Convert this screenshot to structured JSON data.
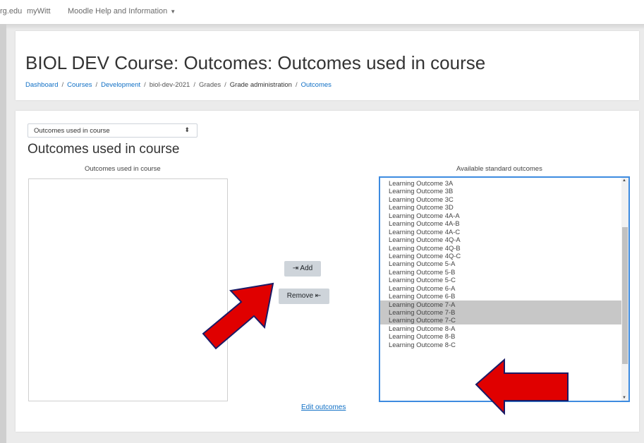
{
  "topnav": {
    "items": [
      "rg.edu",
      "myWitt",
      "Moodle Help and Information"
    ],
    "dropdown_caret": "▼"
  },
  "header": {
    "title": "BIOL DEV Course: Outcomes: Outcomes used in course",
    "breadcrumb": [
      "Dashboard",
      "Courses",
      "Development",
      "biol-dev-2021",
      "Grades",
      "Grade administration",
      "Outcomes"
    ],
    "separator": "/"
  },
  "main": {
    "select_value": "Outcomes used in course",
    "select_arrows": "⬍",
    "section_title": "Outcomes used in course",
    "left_label": "Outcomes used in course",
    "right_label": "Available standard outcomes",
    "add_label": "⇥ Add",
    "remove_label": "Remove ⇤",
    "edit_link": "Edit outcomes",
    "available": [
      {
        "label": "Learning Outcome 3A",
        "selected": false
      },
      {
        "label": "Learning Outcome 3B",
        "selected": false
      },
      {
        "label": "Learning Outcome 3C",
        "selected": false
      },
      {
        "label": "Learning Outcome 3D",
        "selected": false
      },
      {
        "label": "Learning Outcome 4A-A",
        "selected": false
      },
      {
        "label": "Learning Outcome 4A-B",
        "selected": false
      },
      {
        "label": "Learning Outcome 4A-C",
        "selected": false
      },
      {
        "label": "Learning Outcome 4Q-A",
        "selected": false
      },
      {
        "label": "Learning Outcome 4Q-B",
        "selected": false
      },
      {
        "label": "Learning Outcome 4Q-C",
        "selected": false
      },
      {
        "label": "Learning Outcome 5-A",
        "selected": false
      },
      {
        "label": "Learning Outcome 5-B",
        "selected": false
      },
      {
        "label": "Learning Outcome 5-C",
        "selected": false
      },
      {
        "label": "Learning Outcome 6-A",
        "selected": false
      },
      {
        "label": "Learning Outcome 6-B",
        "selected": false
      },
      {
        "label": "Learning Outcome 7-A",
        "selected": true
      },
      {
        "label": "Learning Outcome 7-B",
        "selected": true
      },
      {
        "label": "Learning Outcome 7-C",
        "selected": true
      },
      {
        "label": "Learning Outcome 8-A",
        "selected": false
      },
      {
        "label": "Learning Outcome 8-B",
        "selected": false
      },
      {
        "label": "Learning Outcome 8-C",
        "selected": false
      }
    ],
    "scroll_up": "▲",
    "scroll_down": "▼"
  },
  "colors": {
    "link": "#0f6fc5",
    "focus_border": "#3d8be0",
    "selected_row": "#c7c7c7",
    "button": "#ced4da",
    "annotation_arrow": "#e00000"
  },
  "annotations": {
    "arrow_to_remove_button": "arrow-icon",
    "arrow_to_selected_outcomes": "arrow-icon"
  }
}
